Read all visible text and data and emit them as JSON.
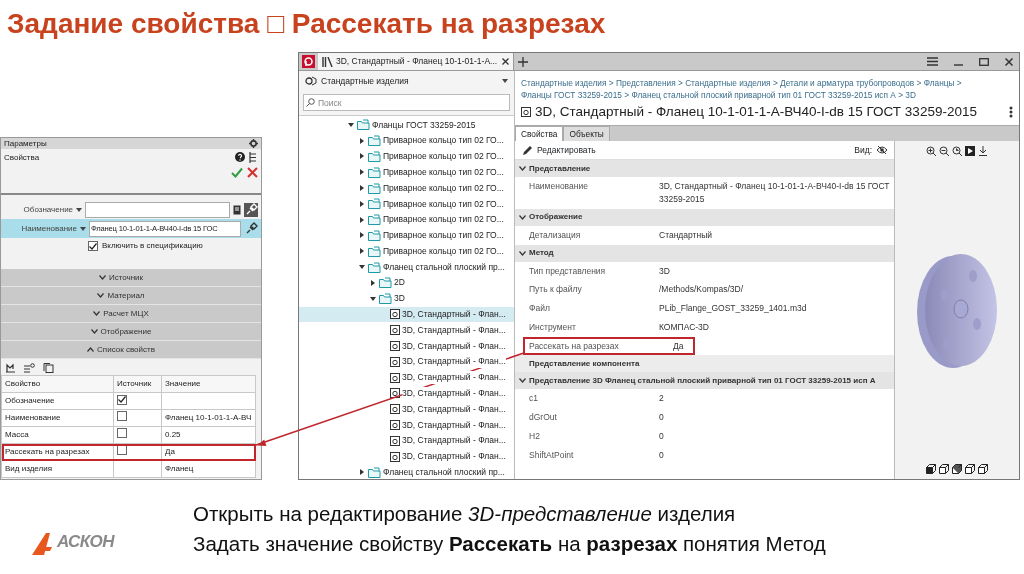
{
  "slide_title": "Задание свойства □ Рассекать на разрезах",
  "parameters_panel": {
    "title": "Параметры",
    "subtitle": "Свойства",
    "fields": [
      {
        "label": "Обозначение",
        "selected": false
      },
      {
        "label": "Наименование",
        "value": "Фланец 10-1-01-1-А-ВЧ40-I-dв 15 ГОС",
        "selected": true
      }
    ],
    "include_checkbox": {
      "label": "Включить в спецификацию",
      "checked": true
    },
    "sections": [
      {
        "label": "Источник",
        "expanded": false
      },
      {
        "label": "Материал",
        "expanded": false
      },
      {
        "label": "Расчет МЦХ",
        "expanded": false
      },
      {
        "label": "Отображение",
        "expanded": false
      },
      {
        "label": "Список свойств",
        "expanded": true
      }
    ],
    "table": {
      "columns": [
        "Свойство",
        "Источник",
        "Значение"
      ],
      "rows": [
        {
          "property": "Обозначение",
          "kind": "checkbox",
          "checked": true,
          "highlighted": false
        },
        {
          "property": "Наименование",
          "kind": "checkbox",
          "checked": false,
          "value": "Фланец 10-1-01-1-А-ВЧ",
          "highlighted": false
        },
        {
          "property": "Масса",
          "kind": "checkbox",
          "checked": false,
          "value": "0.25",
          "highlighted": false
        },
        {
          "property": "Рассекать на разрезах",
          "kind": "checkbox",
          "checked": false,
          "value": "Да",
          "highlighted": true
        },
        {
          "property": "Вид изделия",
          "kind": "plain",
          "value": "Фланец",
          "highlighted": false
        }
      ]
    }
  },
  "window": {
    "tabs": [
      {
        "label": "3D, Стандартный - Фланец 10-1-01-1-А...",
        "selected": true
      }
    ],
    "tree_pane": {
      "source": "Стандартные изделия",
      "search": {
        "placeholder": "Поиск"
      },
      "tree": [
        {
          "label": "Фланцы ГОСТ 33259-2015",
          "kind": "folder",
          "expanded": true,
          "selected": false,
          "children": [
            {
              "label": "Приварное кольцо тип 02 ГО...",
              "kind": "folder",
              "expanded": false,
              "selected": false
            },
            {
              "label": "Приварное кольцо тип 02 ГО...",
              "kind": "folder",
              "expanded": false,
              "selected": false
            },
            {
              "label": "Приварное кольцо тип 02 ГО...",
              "kind": "folder",
              "expanded": false,
              "selected": false
            },
            {
              "label": "Приварное кольцо тип 02 ГО...",
              "kind": "folder",
              "expanded": false,
              "selected": false
            },
            {
              "label": "Приварное кольцо тип 02 ГО...",
              "kind": "folder",
              "expanded": false,
              "selected": false
            },
            {
              "label": "Приварное кольцо тип 02 ГО...",
              "kind": "folder",
              "expanded": false,
              "selected": false
            },
            {
              "label": "Приварное кольцо тип 02 ГО...",
              "kind": "folder",
              "expanded": false,
              "selected": false
            },
            {
              "label": "Приварное кольцо тип 02 ГО...",
              "kind": "folder",
              "expanded": false,
              "selected": false
            },
            {
              "label": "Фланец стальной плоский пр...",
              "kind": "folder",
              "expanded": true,
              "selected": false,
              "children": [
                {
                  "label": "2D",
                  "kind": "folder",
                  "expanded": false,
                  "selected": false
                },
                {
                  "label": "3D",
                  "kind": "folder",
                  "expanded": true,
                  "selected": false,
                  "children": [
                    {
                      "label": "3D, Стандартный - Флан...",
                      "kind": "document",
                      "selected": true
                    },
                    {
                      "label": "3D, Стандартный - Флан...",
                      "kind": "document",
                      "selected": false
                    },
                    {
                      "label": "3D, Стандартный - Флан...",
                      "kind": "document",
                      "selected": false
                    },
                    {
                      "label": "3D, Стандартный - Флан...",
                      "kind": "document",
                      "selected": false
                    },
                    {
                      "label": "3D, Стандартный - Флан...",
                      "kind": "document",
                      "selected": false
                    },
                    {
                      "label": "3D, Стандартный - Флан...",
                      "kind": "document",
                      "selected": false
                    },
                    {
                      "label": "3D, Стандартный - Флан...",
                      "kind": "document",
                      "selected": false
                    },
                    {
                      "label": "3D, Стандартный - Флан...",
                      "kind": "document",
                      "selected": false
                    },
                    {
                      "label": "3D, Стандартный - Флан...",
                      "kind": "document",
                      "selected": false
                    },
                    {
                      "label": "3D, Стандартный - Флан...",
                      "kind": "document",
                      "selected": false
                    }
                  ]
                }
              ]
            },
            {
              "label": "Фланец стальной плоский пр...",
              "kind": "folder",
              "expanded": false,
              "selected": false
            }
          ]
        }
      ]
    },
    "details": {
      "breadcrumb_separator": ">",
      "breadcrumb": [
        "Стандартные изделия",
        "Представления",
        "Стандартные изделия",
        "Детали и арматура трубопроводов",
        "Фланцы",
        "Фланцы ГОСТ 33259-2015",
        "Фланец стальной плоский приварной тип 01 ГОСТ 33259-2015 исп А",
        "3D"
      ],
      "heading": "3D, Стандартный - Фланец 10-1-01-1-А-ВЧ40-I-dв 15 ГОСТ 33259-2015",
      "tabs": [
        {
          "label": "Свойства",
          "selected": true
        },
        {
          "label": "Объекты",
          "selected": false
        }
      ],
      "edit_button": "Редактировать",
      "view_label": "Вид:",
      "groups": [
        {
          "label": "Представление",
          "kind": "group",
          "expanded": true,
          "rows": [
            {
              "label": "Наименование",
              "value": "3D, Стандартный - Фланец 10-1-01-1-А-ВЧ40-I-dв 15 ГОСТ 33259-2015",
              "highlighted": false
            }
          ]
        },
        {
          "label": "Отображение",
          "kind": "group",
          "expanded": true,
          "rows": [
            {
              "label": "Детализация",
              "value": "Стандартный",
              "highlighted": false
            }
          ]
        },
        {
          "label": "Метод",
          "kind": "group",
          "expanded": true,
          "rows": [
            {
              "label": "Тип представления",
              "value": "3D",
              "highlighted": false
            },
            {
              "label": "Путь к файлу",
              "value": "/Methods/Kompas/3D/",
              "highlighted": false
            },
            {
              "label": "Файл",
              "value": "PLib_Flange_GOST_33259_1401.m3d",
              "highlighted": false
            },
            {
              "label": "Инструмент",
              "value": "КОМПАС-3D",
              "highlighted": false
            },
            {
              "label": "Рассекать на разрезах",
              "value": "Да",
              "highlighted": true
            }
          ]
        },
        {
          "label": "Представление компонента",
          "kind": "plain"
        },
        {
          "label": "Представление 3D Фланец стальной плоский приварной тип 01 ГОСТ 33259-2015 исп А",
          "kind": "group",
          "expanded": true,
          "rows": [
            {
              "label": "c1",
              "value": "2",
              "highlighted": false
            },
            {
              "label": "dGrOut",
              "value": "0",
              "highlighted": false
            },
            {
              "label": "H2",
              "value": "0",
              "highlighted": false
            },
            {
              "label": "ShiftAtPoint",
              "value": "0",
              "highlighted": false
            }
          ]
        }
      ]
    }
  },
  "caption": [
    "Открыть на редактирование *3D-представление* изделия",
    "Задать значение свойству **Рассекать** на **разрезах** понятия Метод"
  ],
  "logo_text": "АСКОН"
}
